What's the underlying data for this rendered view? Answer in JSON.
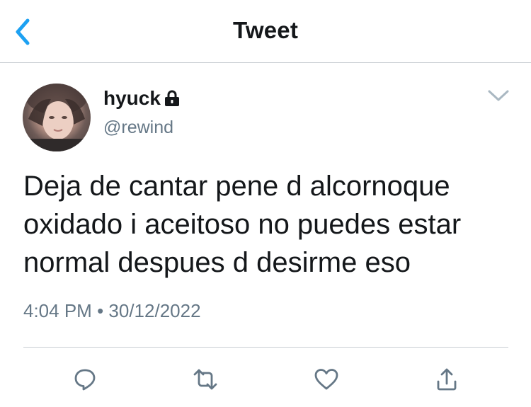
{
  "header": {
    "title": "Tweet",
    "back_icon": "chevron-left-icon",
    "accent_color": "#1da1f2"
  },
  "author": {
    "display_name": "hyuck",
    "handle": "@rewind",
    "protected_icon": "lock-icon"
  },
  "tweet": {
    "text_lines": [
      "Deja de cantar pene d alcornoque",
      "oxidado i aceitoso no puedes estar",
      "normal despues d desirme eso"
    ],
    "time": "4:04 PM",
    "separator": "•",
    "date": "30/12/2022"
  },
  "actions": [
    {
      "name": "reply",
      "icon": "reply-icon"
    },
    {
      "name": "retweet",
      "icon": "retweet-icon"
    },
    {
      "name": "like",
      "icon": "heart-icon"
    },
    {
      "name": "share",
      "icon": "share-icon"
    }
  ],
  "colors": {
    "text": "#14171a",
    "secondary": "#657786",
    "divider": "#c8cdd2",
    "icon": "#657786"
  }
}
